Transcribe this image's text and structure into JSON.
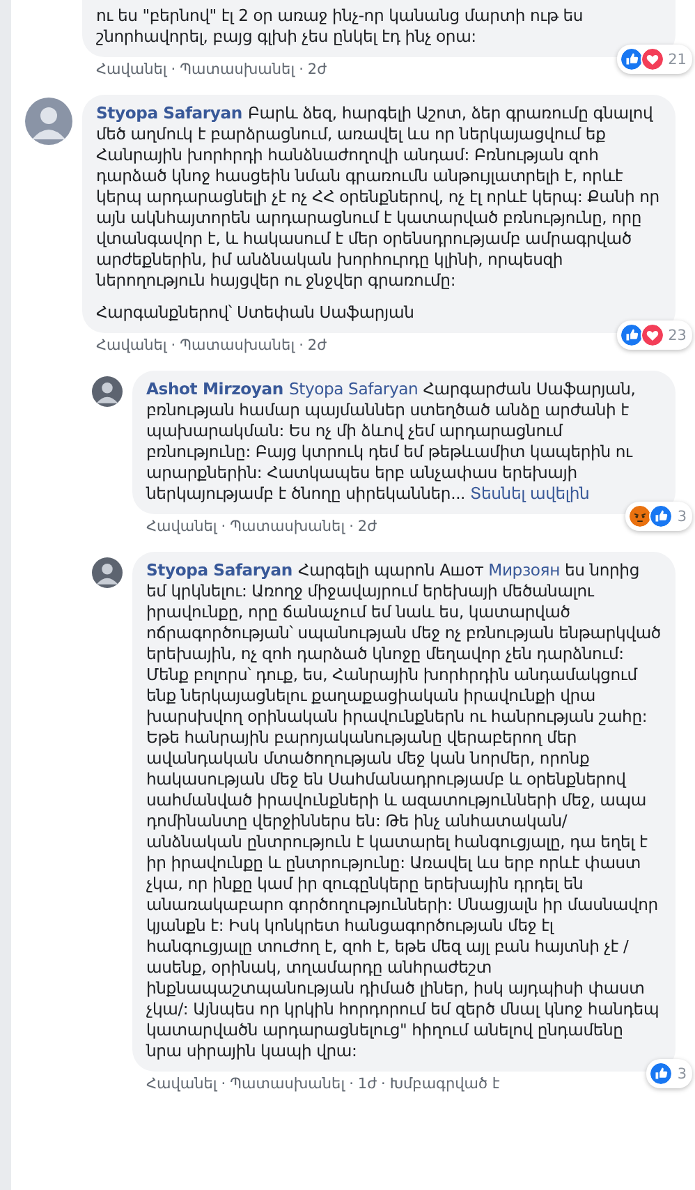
{
  "separator": "·",
  "comments": [
    {
      "paragraphs": [
        [
          {
            "kind": "text",
            "text": "ու ես \"բերնով\" էլ 2 օր առաջ ինչ-որ կանանց մարտի ութ ես շնորհավորել, բայց գլխի չես ընկել էդ ինչ օրա:"
          }
        ]
      ],
      "reactions": {
        "icons": [
          {
            "kind": "like"
          },
          {
            "kind": "love"
          }
        ],
        "count": "21"
      },
      "footer": {
        "like": "Հավանել",
        "reply": "Պատասխանել",
        "time": "2ժ"
      }
    },
    {
      "author": "Styopa Safaryan",
      "paragraphs": [
        [
          {
            "kind": "text",
            "text": "Բարև ձեզ, հարգելի Աշոտ, ձեր գրառումը գնալով մեծ աղմուկ է բարձրացնում, առավել ևս որ ներկայացվում եք Հանրային խորհրդի հանձնաժողովի անդամ: Բռնության զոհ դարձած կնոջ հասցեին նման գրառումն անթույլատրելի է, որևէ կերպ արդարացնելի չէ ոչ ՀՀ օրենքներով, ոչ էլ որևէ կերպ: Քանի որ այն ակնհայտորեն արդարացնում է կատարված բռնությունը, որը վտանգավոր է, և հակասում է մեր օրենսդրությամբ ամրագրված արժեքներին, իմ անձնական խորհուրդը կլինի, որպեսզի ներողություն հայցվեր ու ջնջվեր գրառումը:"
          }
        ],
        [
          {
            "kind": "text",
            "text": "Հարգանքներով՝ Ստեփան Սաֆարյան"
          }
        ]
      ],
      "reactions": {
        "icons": [
          {
            "kind": "like"
          },
          {
            "kind": "love"
          }
        ],
        "count": "23"
      },
      "footer": {
        "like": "Հավանել",
        "reply": "Պատասխանել",
        "time": "2ժ"
      },
      "children": [
        {
          "author": "Ashot Mirzoyan",
          "paragraphs": [
            [
              {
                "kind": "mention",
                "text": "Styopa Safaryan"
              },
              {
                "kind": "text",
                "text": " Հարգարժան Սաֆարյան, բռնության համար պայմաններ ստեղծած անձը արժանի է պախարակման: Ես ոչ մի ձևով չեմ արդարացնում բռնությունը: Բայց կտրուկ դեմ եմ թեթևամիտ կապերին ու արարքներին: Հատկապես երբ անչափաս երեխայի ներկայությամբ է ծնողը սիրեկաններ... "
              },
              {
                "kind": "more",
                "text": "Տեսնել ավելին"
              }
            ]
          ],
          "reactions": {
            "icons": [
              {
                "kind": "angry"
              },
              {
                "kind": "like"
              }
            ],
            "count": "3"
          },
          "footer": {
            "like": "Հավանել",
            "reply": "Պատասխանել",
            "time": "2ժ"
          }
        },
        {
          "author": "Styopa Safaryan",
          "paragraphs": [
            [
              {
                "kind": "text",
                "text": "Հարգելի պարոն Ашот "
              },
              {
                "kind": "mention",
                "text": "Мирзоян"
              },
              {
                "kind": "text",
                "text": " ես նորից եմ կրկնելու: Առողջ միջավայրում երեխայի մեծանալու իրավունքը, որը ճանաչում եմ նաև ես, կատարված ոճրագործության՝ սպանության մեջ ոչ բռնության ենթարկված երեխային, ոչ զոհ դարձած կնոջը մեղավոր չեն դարձնում: Մենք բոլորս՝ դուք, ես, Հանրային խորհրդին անդամակցում ենք ներկայացնելու քաղաքացիական իրավունքի վրա խարսխվող օրինական իրավունքներն ու հանրության շահը: Եթե հանրային բարոյականությանը վերաբերող մեր ավանդական մտածողության մեջ կան նորմեր, որոնք հակասության մեջ են Սահմանադրությամբ և օրենքներով սահմանված իրավունքների և ազատությունների մեջ, ապա դոմինանտը վերջիններս են: Թե ինչ անհատական/անձնական ընտրություն է կատարել հանգուցյալը, դա եղել է իր իրավունքը և ընտրությունը: Առավել ևս երբ որևէ փաստ չկա, որ ինքը կամ իր զուգընկերը երեխային դրդել են անառակաբարո գործողությունների: Սնացյալն իր մասնավոր կյանքն է: Իսկ կոնկրետ հանցագործության մեջ էլ հանգուցյալը տուժող է, զոհ է, եթե մեզ այլ բան հայտնի չէ / ասենք, օրինակ, տղամարդը անհրաժեշտ ինքնապաշտպանության դիմած լիներ, իսկ այդպիսի փաստ չկա/: Այնպես որ կրկին հորդորում եմ զերծ մնալ կնոջ հանդեպ կատարվածն արդարացնելուց\" հիղում անելով ընդամենը նրա սիրային կապի վրա:"
              }
            ]
          ],
          "reactions": {
            "icons": [
              {
                "kind": "like"
              }
            ],
            "count": "3"
          },
          "footer": {
            "like": "Հավանել",
            "reply": "Պատասխանել",
            "time": "1ժ",
            "edited": "Խմբագրված է"
          }
        }
      ]
    }
  ]
}
